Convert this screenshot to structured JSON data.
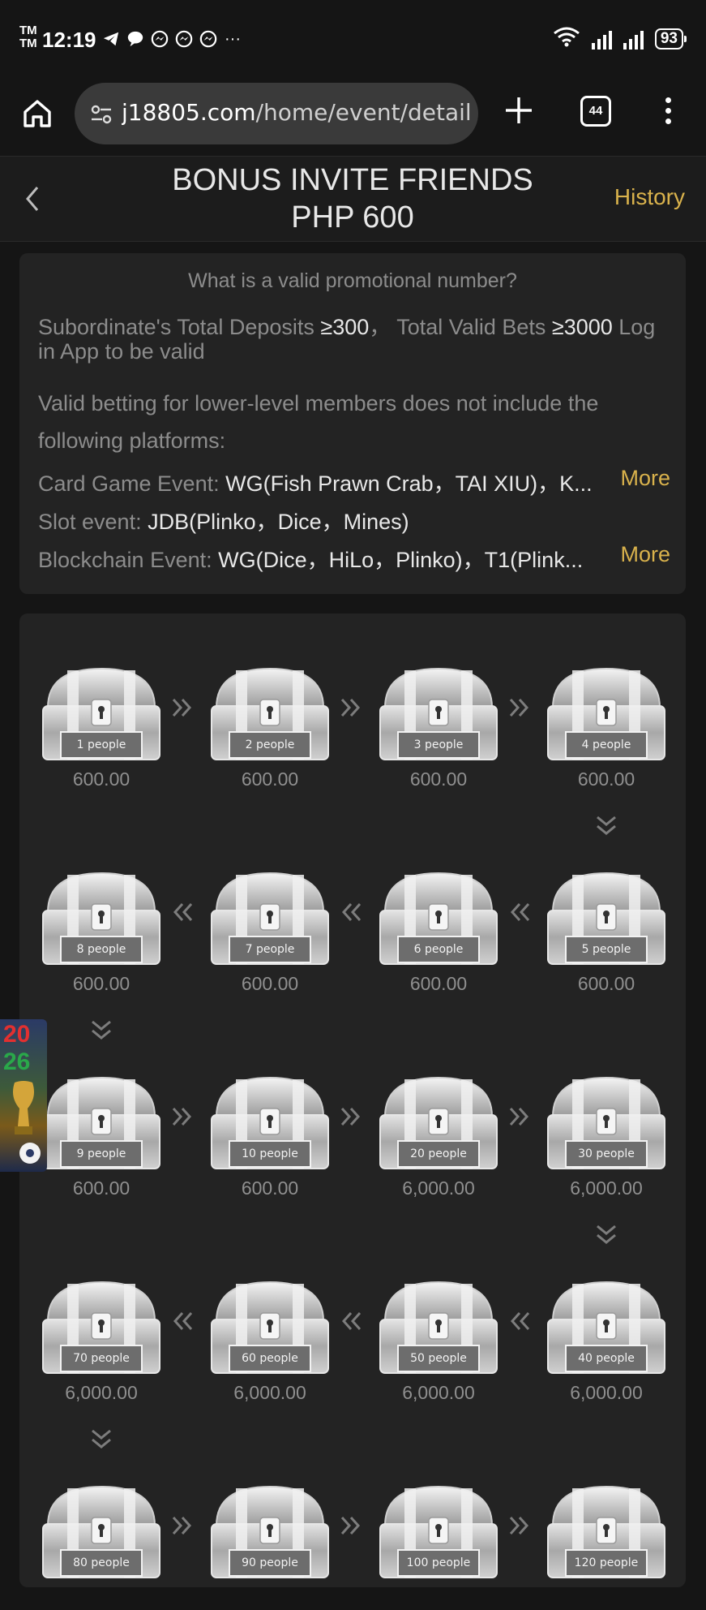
{
  "status_bar": {
    "tm": "TM\nTM",
    "time": "12:19",
    "overflow": "···",
    "battery": "93",
    "icons": [
      "telegram-icon",
      "chat-icon",
      "messenger-icon",
      "messenger-icon",
      "messenger-icon",
      "wifi-icon",
      "signal-icon",
      "signal-icon"
    ]
  },
  "browser": {
    "url_domain": "j18805.com",
    "url_path": "/home/event/detail?",
    "tab_count": "44"
  },
  "header": {
    "title_line1": "BONUS INVITE FRIENDS",
    "title_line2": "PHP 600",
    "history": "History"
  },
  "info": {
    "question": "What is a valid promotional number?",
    "req_a": "Subordinate's Total Deposits ",
    "req_a_val": "≥300",
    "req_b": "， Total Valid Bets ",
    "req_b_val": "≥3000",
    "req_c": " Log in App to be valid",
    "exclusion": "Valid betting for lower-level members does not include the",
    "exclusion2": "following platforms:",
    "card_label": "Card Game Event: ",
    "card_value": "WG(Fish Prawn Crab，TAI XIU)，K...",
    "slot_label": "Slot event: ",
    "slot_value": "JDB(Plinko，Dice，Mines)",
    "chain_label": "Blockchain Event: ",
    "chain_value": "WG(Dice，HiLo，Plinko)，T1(Plink...",
    "more": "More"
  },
  "rewards": [
    {
      "label": "1 people",
      "amount": "600.00"
    },
    {
      "label": "2 people",
      "amount": "600.00"
    },
    {
      "label": "3 people",
      "amount": "600.00"
    },
    {
      "label": "4 people",
      "amount": "600.00"
    },
    {
      "label": "5 people",
      "amount": "600.00"
    },
    {
      "label": "6 people",
      "amount": "600.00"
    },
    {
      "label": "7 people",
      "amount": "600.00"
    },
    {
      "label": "8 people",
      "amount": "600.00"
    },
    {
      "label": "9 people",
      "amount": "600.00"
    },
    {
      "label": "10 people",
      "amount": "600.00"
    },
    {
      "label": "20 people",
      "amount": "6,000.00"
    },
    {
      "label": "30 people",
      "amount": "6,000.00"
    },
    {
      "label": "40 people",
      "amount": "6,000.00"
    },
    {
      "label": "50 people",
      "amount": "6,000.00"
    },
    {
      "label": "60 people",
      "amount": "6,000.00"
    },
    {
      "label": "70 people",
      "amount": "6,000.00"
    },
    {
      "label": "80 people",
      "amount": ""
    },
    {
      "label": "90 people",
      "amount": ""
    },
    {
      "label": "100 people",
      "amount": ""
    },
    {
      "label": "120 people",
      "amount": ""
    }
  ],
  "badge": {
    "top": "20",
    "bottom": "26"
  }
}
